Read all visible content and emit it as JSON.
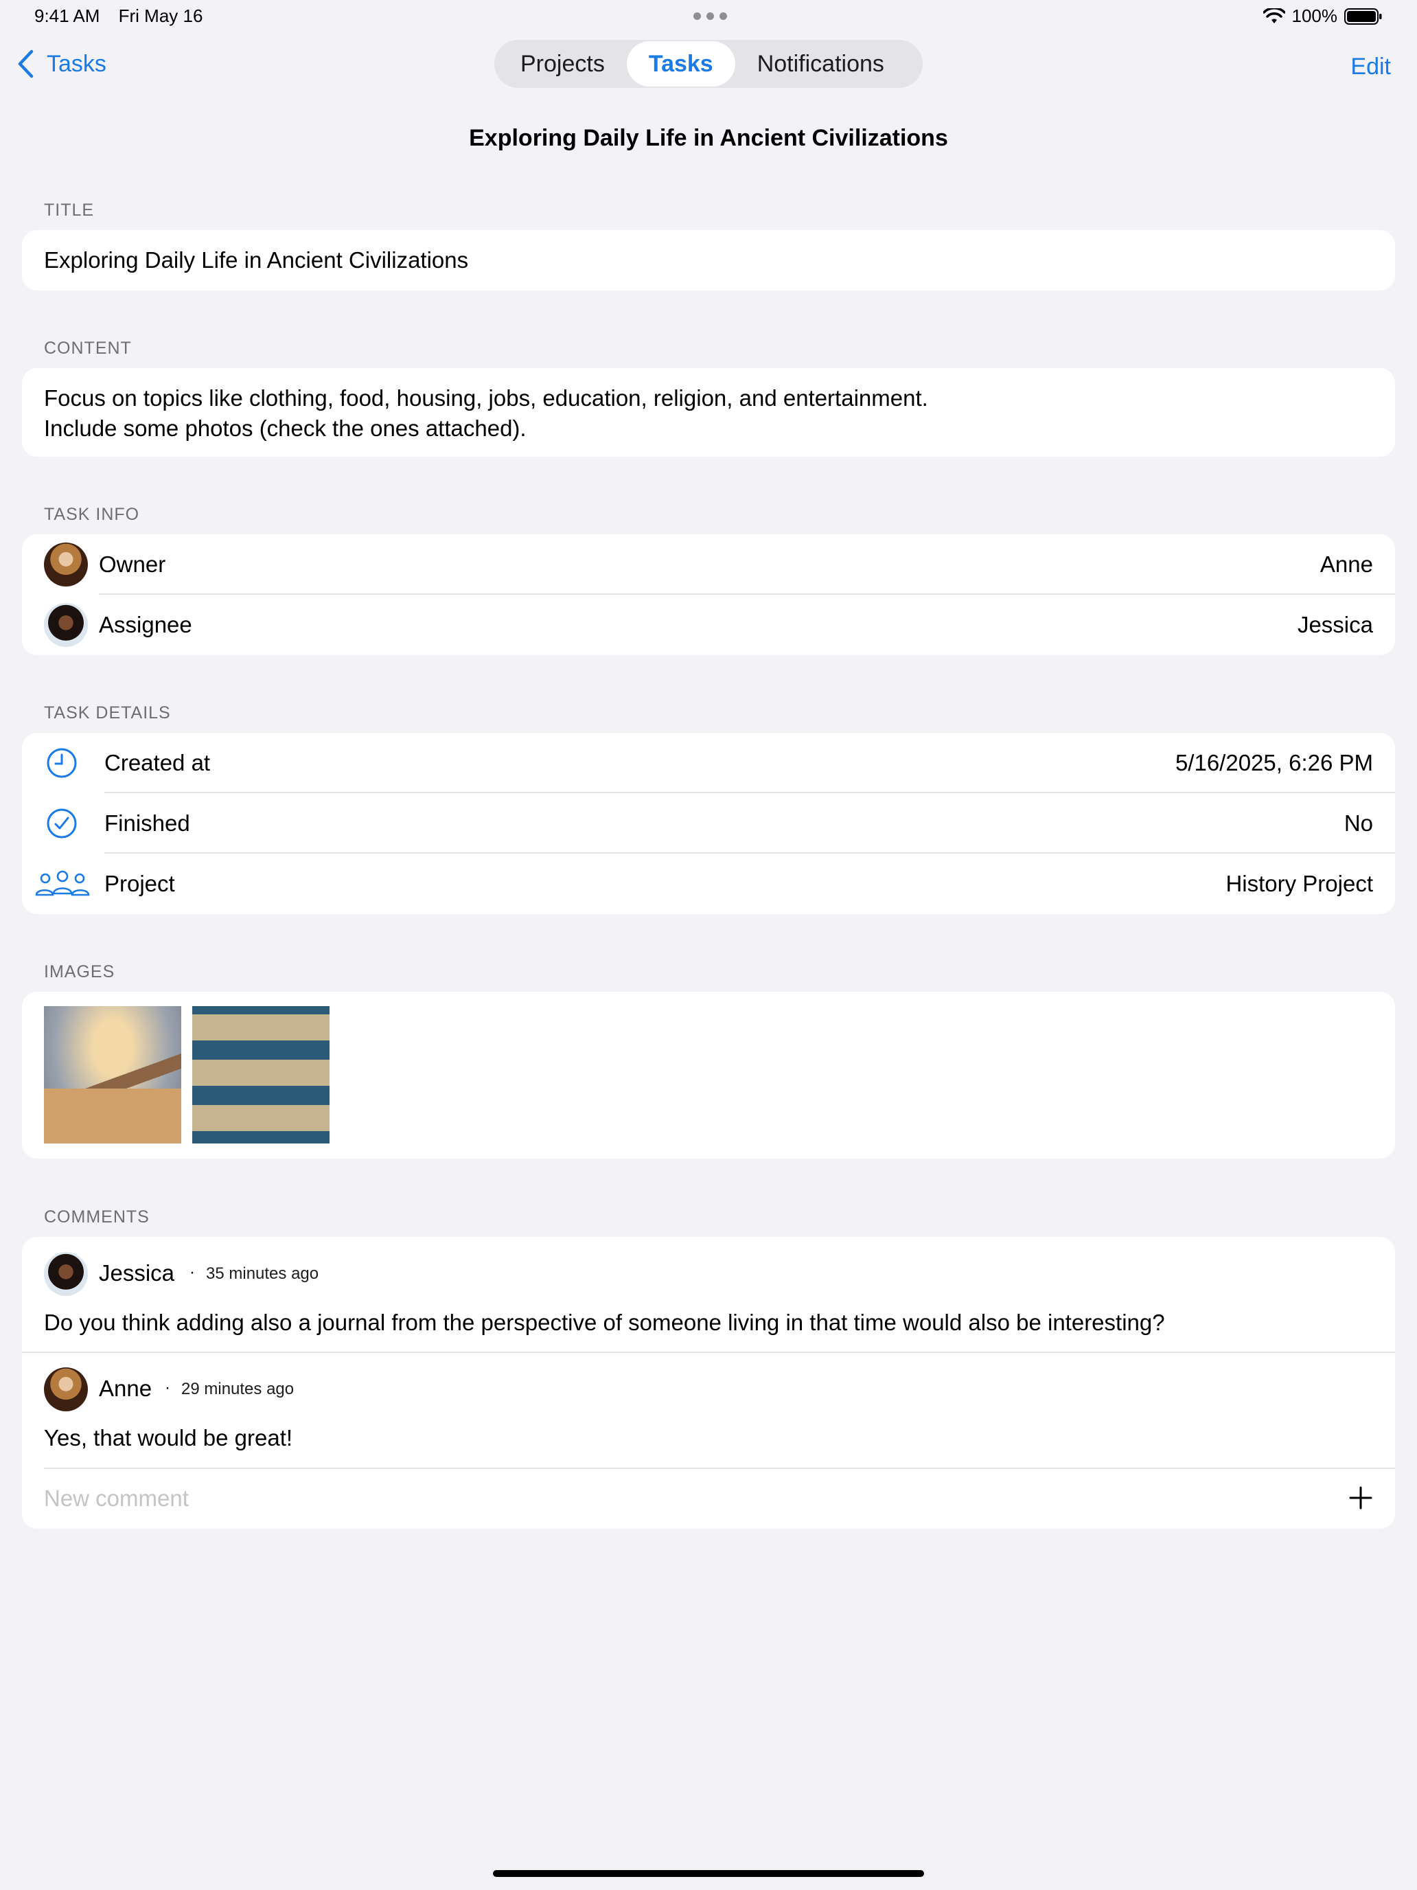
{
  "status_bar": {
    "time": "9:41 AM",
    "date": "Fri May 16",
    "battery": "100%"
  },
  "nav": {
    "back_label": "Tasks",
    "segments": [
      "Projects",
      "Tasks",
      "Notifications"
    ],
    "active_segment": "Tasks",
    "edit_label": "Edit"
  },
  "page_title": "Exploring Daily Life in Ancient Civilizations",
  "sections": {
    "title": {
      "label": "TITLE",
      "value": "Exploring Daily Life in Ancient Civilizations"
    },
    "content": {
      "label": "CONTENT",
      "line1": "Focus on topics like clothing, food, housing, jobs, education, religion, and entertainment.",
      "line2": "Include some photos (check the ones attached)."
    },
    "task_info": {
      "label": "TASK INFO",
      "owner_label": "Owner",
      "owner_value": "Anne",
      "assignee_label": "Assignee",
      "assignee_value": "Jessica"
    },
    "task_details": {
      "label": "TASK DETAILS",
      "created_label": "Created at",
      "created_value": "5/16/2025, 6:26 PM",
      "finished_label": "Finished",
      "finished_value": "No",
      "project_label": "Project",
      "project_value": "History Project",
      "icons": [
        "clock-icon",
        "checkmark-circle-icon",
        "people-icon"
      ]
    },
    "images": {
      "label": "IMAGES"
    },
    "comments": {
      "label": "COMMENTS",
      "items": [
        {
          "author": "Jessica",
          "time": "35 minutes ago",
          "text": "Do you think adding also a journal from the perspective of someone living in that time would also be interesting?"
        },
        {
          "author": "Anne",
          "time": "29 minutes ago",
          "text": "Yes, that would be great!"
        }
      ],
      "separator": "·",
      "new_comment_placeholder": "New comment"
    }
  },
  "colors": {
    "accent": "#1A7AE6",
    "background": "#F2F2F7",
    "card": "#FFFFFF",
    "secondary_text": "#6D6D72"
  }
}
